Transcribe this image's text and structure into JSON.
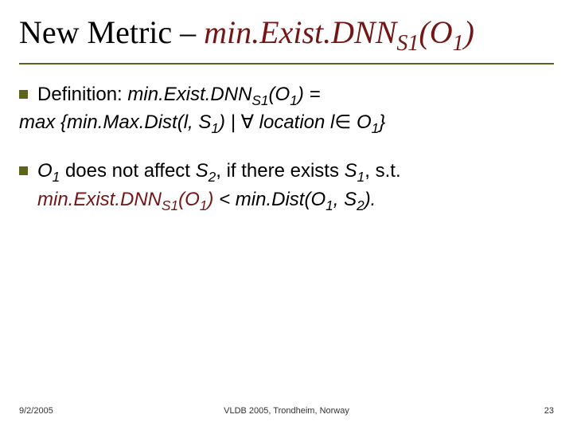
{
  "title": {
    "prefix": "New Metric – ",
    "metric_name": "min.Exist.DNN",
    "metric_sub": "S1",
    "metric_arg_open": "(O",
    "metric_arg_sub": "1",
    "metric_arg_close": ")"
  },
  "bullets": [
    {
      "lead": "Definition: ",
      "expr_main": "min.Exist.DNN",
      "expr_sub": "S1",
      "expr_arg": "(O",
      "expr_argsub": "1",
      "expr_argclose": ") =",
      "line2_prefix": "max {min.Max.Dist(",
      "line2_l": "l",
      "line2_mid1": ", S",
      "line2_s1sub": "1",
      "line2_mid2": ") | ",
      "line2_forall": "∀",
      "line2_loc": " location ",
      "line2_l2": "l",
      "line2_in": "∈",
      "line2_o": " O",
      "line2_osub": "1",
      "line2_close": "}"
    },
    {
      "p1": "O",
      "p1sub": "1",
      "p2": " does not affect ",
      "p3": "S",
      "p3sub": "2",
      "p4": ", if there exists ",
      "p5": "S",
      "p5sub": "1",
      "p6": ", s.t. ",
      "accent_main": "min.Exist.DNN",
      "accent_sub": "S1",
      "accent_arg": "(O",
      "accent_argsub": "1",
      "accent_argclose": ")",
      "cmp": " < ",
      "md": "min.Dist(O",
      "md_sub1": "1",
      "md_mid": ", S",
      "md_sub2": "2",
      "md_close": ")."
    }
  ],
  "footer": {
    "date": "9/2/2005",
    "venue": "VLDB 2005, Trondheim, Norway",
    "page": "23"
  }
}
